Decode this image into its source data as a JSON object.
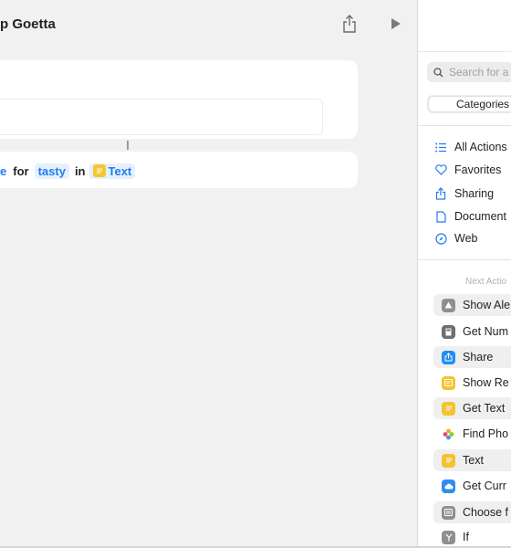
{
  "toolbar": {
    "title": "p Goetta"
  },
  "action_row": {
    "var_fragment": "e",
    "word_for": "for",
    "token_tasty": "tasty",
    "word_in": "in",
    "token_text": "Text"
  },
  "sidebar": {
    "search_placeholder": "Search for a",
    "segment_label": "Categories",
    "categories": [
      {
        "label": "All Actions",
        "icon": "list-icon"
      },
      {
        "label": "Favorites",
        "icon": "heart-icon"
      },
      {
        "label": "Sharing",
        "icon": "share-icon"
      },
      {
        "label": "Document",
        "icon": "document-icon"
      },
      {
        "label": "Web",
        "icon": "compass-icon"
      }
    ],
    "next_label": "Next Actio",
    "actions": [
      {
        "label": "Show Ale",
        "icon": "alert-icon",
        "color": "#8e8e93"
      },
      {
        "label": "Get Num",
        "icon": "calculator-icon",
        "color": "#6e6e73"
      },
      {
        "label": "Share",
        "icon": "share-icon",
        "color": "#1e8ef5"
      },
      {
        "label": "Show Re",
        "icon": "result-icon",
        "color": "#f5c231"
      },
      {
        "label": "Get Text",
        "icon": "text-icon",
        "color": "#f5c231"
      },
      {
        "label": "Find Pho",
        "icon": "photos-icon",
        "color": "#e85a8a"
      },
      {
        "label": "Text",
        "icon": "text-icon",
        "color": "#f5c231"
      },
      {
        "label": "Get Curr",
        "icon": "weather-icon",
        "color": "#2f8ef0"
      },
      {
        "label": "Choose f",
        "icon": "menu-icon",
        "color": "#8e8e93"
      },
      {
        "label": "If",
        "icon": "branch-icon",
        "color": "#8e8e93"
      }
    ]
  },
  "colors": {
    "accent": "#1e7cf2",
    "text_chip": "#f6c730"
  }
}
